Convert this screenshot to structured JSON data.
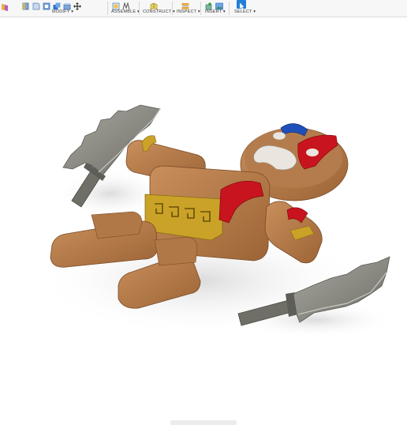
{
  "toolbar": {
    "groups": [
      {
        "label": "MODIFY ▾",
        "icons": [
          "press-pull-icon",
          "fillet-icon",
          "shell-icon",
          "combine-icon",
          "scale-icon",
          "move-icon"
        ]
      },
      {
        "label": "ASSEMBLE ▾",
        "icons": [
          "new-component-icon",
          "joint-icon"
        ]
      },
      {
        "label": "CONSTRUCT ▾",
        "icons": [
          "offset-plane-icon"
        ]
      },
      {
        "label": "INSPECT ▾",
        "icons": [
          "measure-icon"
        ]
      },
      {
        "label": "INSERT ▾",
        "icons": [
          "insert-derive-icon",
          "insert-image-icon"
        ]
      },
      {
        "label": "SELECT ▾",
        "icons": [
          "select-arrow-icon"
        ]
      }
    ]
  },
  "colors": {
    "body": "#b37a4c",
    "accent_red": "#c8141e",
    "gold": "#c9a227",
    "blue": "#1f4fb8",
    "blade": "#8f8f86",
    "select_active": "#1f7fd6"
  }
}
